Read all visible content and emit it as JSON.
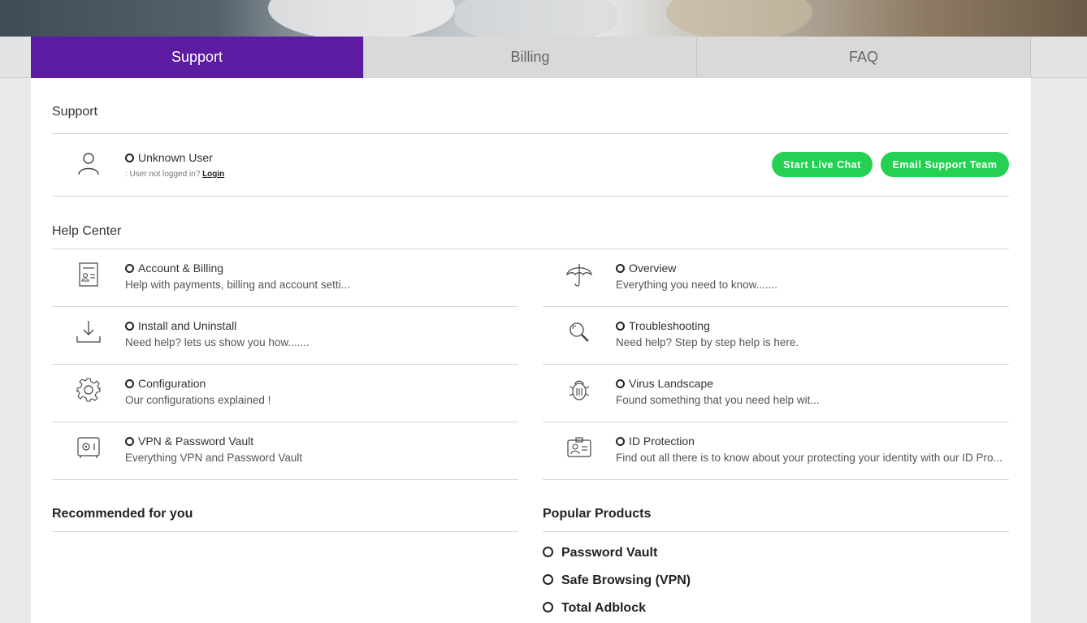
{
  "tabs": [
    {
      "label": "Support",
      "active": true
    },
    {
      "label": "Billing",
      "active": false
    },
    {
      "label": "FAQ",
      "active": false
    }
  ],
  "support": {
    "title": "Support",
    "user_name": "Unknown User",
    "user_sub": ": User not logged in?",
    "login_link": "Login",
    "live_chat_button": "Start Live Chat",
    "email_button": "Email Support Team"
  },
  "help_center": {
    "title": "Help Center",
    "left": [
      {
        "icon": "document-icon",
        "title": "Account & Billing",
        "desc": "Help with payments, billing and account setti..."
      },
      {
        "icon": "download-icon",
        "title": "Install and Uninstall",
        "desc": "Need help? lets us show you how......."
      },
      {
        "icon": "gear-icon",
        "title": "Configuration",
        "desc": "Our configurations explained !"
      },
      {
        "icon": "vault-icon",
        "title": "VPN & Password Vault",
        "desc": "Everything VPN and Password Vault"
      }
    ],
    "right": [
      {
        "icon": "umbrella-icon",
        "title": "Overview",
        "desc": "Everything you need to know......."
      },
      {
        "icon": "magnifier-icon",
        "title": "Troubleshooting",
        "desc": "Need help? Step by step help is here."
      },
      {
        "icon": "bug-icon",
        "title": "Virus Landscape",
        "desc": "Found something that you need help wit..."
      },
      {
        "icon": "id-card-icon",
        "title": "ID Protection",
        "desc": "Find out all there is to know about your protecting your identity with our ID Pro..."
      }
    ]
  },
  "recommended": {
    "title": "Recommended for you"
  },
  "popular": {
    "title": "Popular Products",
    "items": [
      "Password Vault",
      "Safe Browsing (VPN)",
      "Total Adblock"
    ]
  },
  "colors": {
    "accent": "#5c1ba0",
    "button": "#25d052"
  }
}
